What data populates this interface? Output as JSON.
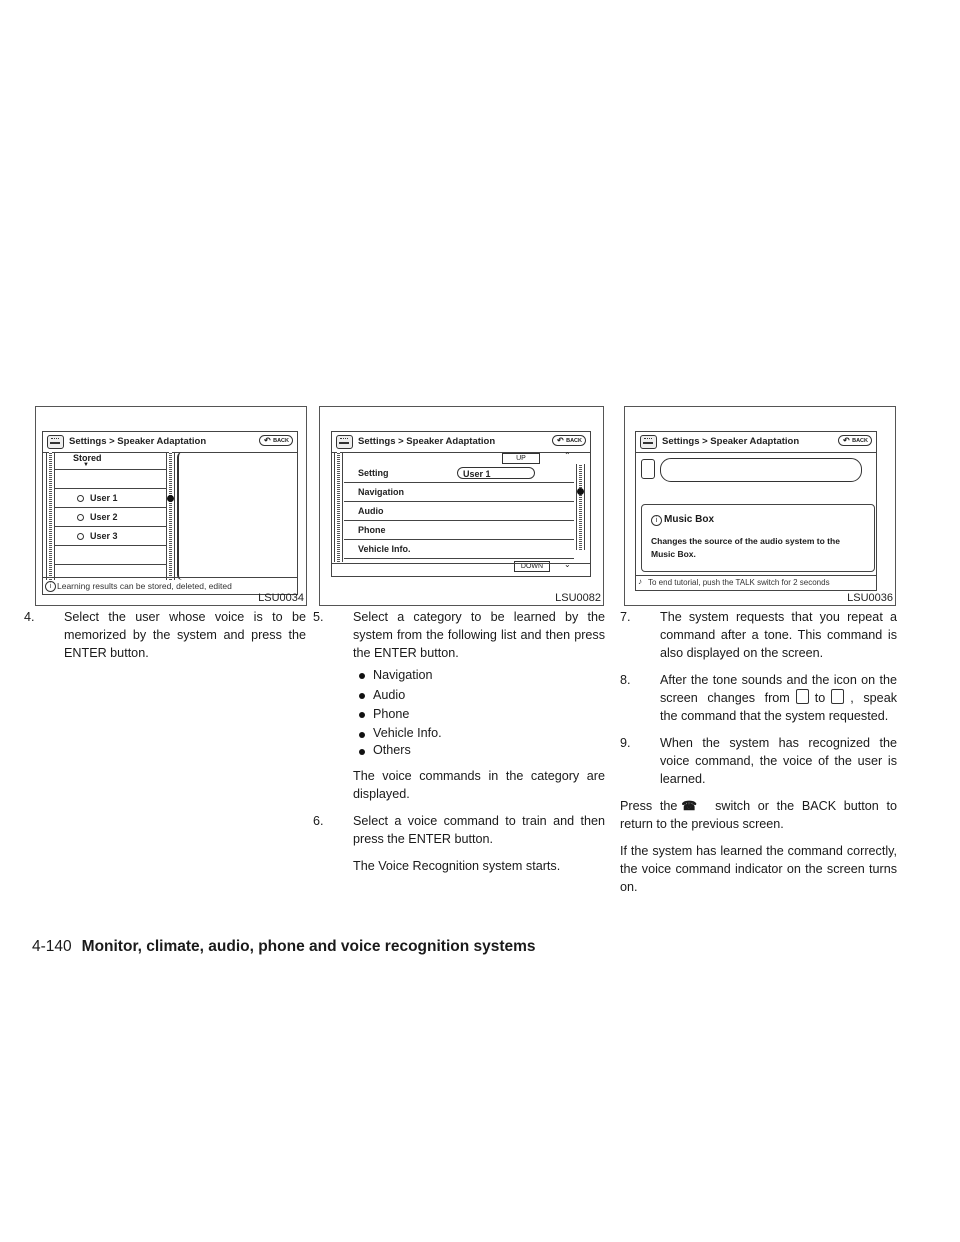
{
  "figures": [
    {
      "id": "LSU0034",
      "screen": {
        "title": "Settings > Speaker Adaptation",
        "back_label": "BACK",
        "header_label": "Stored",
        "items": [
          "User 1",
          "User 2",
          "User 3"
        ],
        "footer": "Learning results can be stored, deleted, edited"
      }
    },
    {
      "id": "LSU0082",
      "screen": {
        "title": "Settings > Speaker Adaptation",
        "back_label": "BACK",
        "up_label": "UP",
        "down_label": "DOWN",
        "setting_label": "Setting",
        "setting_value": "User 1",
        "items": [
          "Navigation",
          "Audio",
          "Phone",
          "Vehicle Info."
        ]
      }
    },
    {
      "id": "LSU0036",
      "screen": {
        "title": "Settings > Speaker Adaptation",
        "back_label": "BACK",
        "card_title": "Music Box",
        "card_text": "Changes the source of the audio system to the Music Box.",
        "footer": "To end tutorial, push the TALK switch for 2 seconds"
      }
    }
  ],
  "columns": {
    "col1": {
      "step4_num": "4.",
      "step4_text": "Select the user whose voice is to be memorized by the system and press the ENTER button."
    },
    "col2": {
      "step5_num": "5.",
      "step5_text": "Select a category to be learned by the system from the following list and then press the ENTER button.",
      "bullets": [
        "Navigation",
        "Audio",
        "Phone",
        "Vehicle Info.",
        "Others"
      ],
      "after_bullets": "The voice commands in the category are displayed.",
      "step6_num": "6.",
      "step6_text": "Select a voice command to train and then press the ENTER button.",
      "step6_note": "The Voice Recognition system starts."
    },
    "col3": {
      "step7_num": "7.",
      "step7_text": "The system requests that you repeat a command after a tone. This command is also displayed on the screen.",
      "step8_num": "8.",
      "step8_a": "After the tone sounds and the icon on the screen changes from",
      "step8_to": "to",
      "step8_b": ", speak the command that the system requested.",
      "step9_num": "9.",
      "step9_text": "When the system has recognized the voice command, the voice of the user is learned.",
      "press_a": "Press the",
      "press_b": "switch or the BACK button to return to the previous screen.",
      "final": "If the system has learned the command correctly, the voice command indicator on the screen turns on."
    }
  },
  "footer": {
    "page": "4-140",
    "title": "Monitor, climate, audio, phone and voice recognition systems"
  }
}
